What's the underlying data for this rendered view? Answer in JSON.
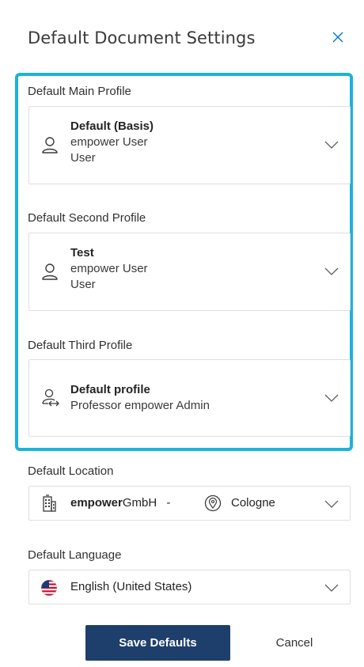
{
  "dialog": {
    "title": "Default Document Settings"
  },
  "main_profile": {
    "label": "Default Main Profile",
    "name": "Default (Basis)",
    "line2": "empower User",
    "line3": "User"
  },
  "second_profile": {
    "label": "Default Second Profile",
    "name": "Test",
    "line2": "empower User",
    "line3": "User"
  },
  "third_profile": {
    "label": "Default Third Profile",
    "name": "Default profile",
    "line2": "Professor empower Admin"
  },
  "location": {
    "label": "Default Location",
    "company_bold": "empower",
    "company_rest": "GmbH",
    "separator": "-",
    "city": "Cologne"
  },
  "language": {
    "label": "Default Language",
    "value": "English (United States)"
  },
  "buttons": {
    "save": "Save Defaults",
    "cancel": "Cancel"
  },
  "colors": {
    "highlight_border": "#1ab4d9",
    "primary_button": "#1e3f6b",
    "close_icon": "#0078d4"
  }
}
